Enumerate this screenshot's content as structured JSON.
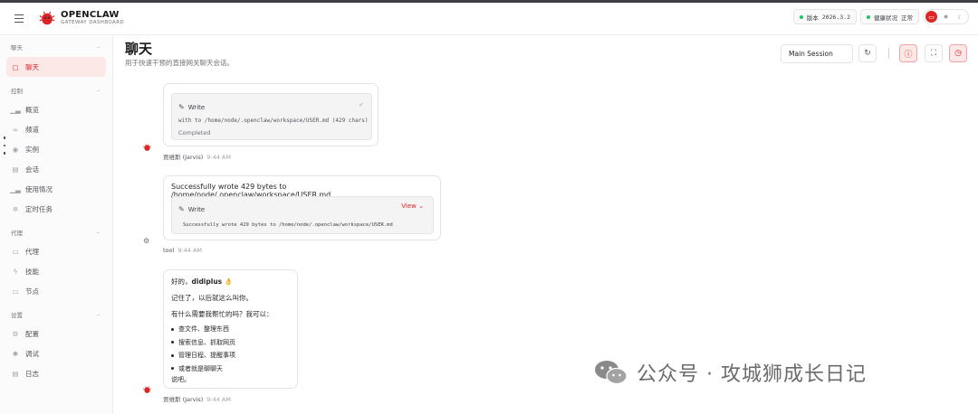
{
  "header": {
    "brand_name": "OPENCLAW",
    "brand_sub": "GATEWAY DASHBOARD",
    "version_label": "版本",
    "version_value": "2026.3.2",
    "health_label": "健康状况",
    "health_value": "正常"
  },
  "sidebar": {
    "sections": [
      {
        "title": "聊天",
        "items": [
          {
            "label": "聊天",
            "icon": "chat-bubble-icon",
            "active": true
          }
        ]
      },
      {
        "title": "控制",
        "items": [
          {
            "label": "概览",
            "icon": "bar-chart-icon"
          },
          {
            "label": "频道",
            "icon": "link-icon"
          },
          {
            "label": "实例",
            "icon": "broadcast-icon"
          },
          {
            "label": "会话",
            "icon": "document-icon"
          },
          {
            "label": "使用情况",
            "icon": "bar-chart-icon"
          },
          {
            "label": "定时任务",
            "icon": "loader-icon"
          }
        ]
      },
      {
        "title": "代理",
        "items": [
          {
            "label": "代理",
            "icon": "folder-icon"
          },
          {
            "label": "技能",
            "icon": "lightning-icon"
          },
          {
            "label": "节点",
            "icon": "monitor-icon"
          }
        ]
      },
      {
        "title": "设置",
        "items": [
          {
            "label": "配置",
            "icon": "gear-icon"
          },
          {
            "label": "调试",
            "icon": "bug-icon"
          },
          {
            "label": "日志",
            "icon": "log-icon"
          }
        ]
      }
    ]
  },
  "main": {
    "title": "聊天",
    "subtitle": "用于快速干预的直接网关聊天会话。",
    "session_select": "Main Session",
    "messages": {
      "first": {
        "tool_name": "Write",
        "tool_args": "with to /home/node/.openclaw/workspace/USER.md (429 chars)",
        "tool_status": "Completed",
        "sender": "贾维斯 (Jarvis)",
        "time": "9:44 AM"
      },
      "second": {
        "text": "Successfully wrote 429 bytes to /home/node/.openclaw/workspace/USER.md",
        "tool_name": "Write",
        "view_label": "View",
        "tool_output": "Successfully wrote 429 bytes to /home/node/.openclaw/workspace/USER.md",
        "sender": "tool",
        "time": "9:44 AM"
      },
      "third": {
        "greeting_prefix": "好的，",
        "greeting_name": "didiplus",
        "greeting_emoji": "👌",
        "line1": "记住了，以后就这么叫你。",
        "line2": "有什么需要我帮忙的吗？我可以：",
        "bullets": [
          "查文件、整理东西",
          "搜索信息、抓取网页",
          "管理日程、提醒事项",
          "或者就是聊聊天"
        ],
        "closing": "说吧。",
        "sender": "贾维斯 (Jarvis)",
        "time": "9:44 AM"
      }
    }
  },
  "watermark": "公众号 · 攻城狮成长日记",
  "colors": {
    "accent": "#dc2626",
    "accent_bg": "#fde8e8",
    "ok": "#22c55e"
  }
}
